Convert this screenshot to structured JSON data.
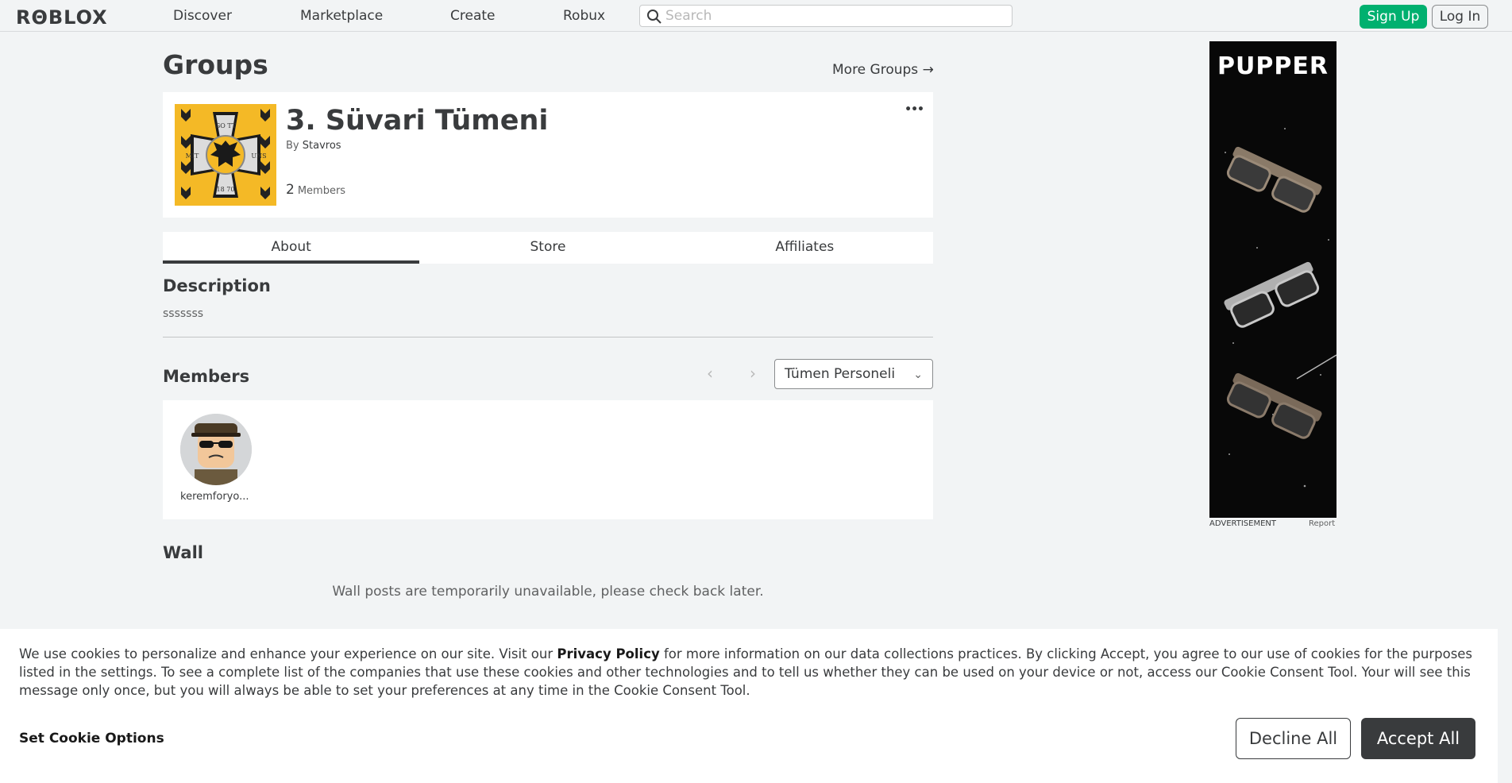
{
  "topbar": {
    "logo": "RΘBLOX",
    "nav": [
      "Discover",
      "Marketplace",
      "Create",
      "Robux"
    ],
    "search_placeholder": "Search",
    "signup_label": "Sign Up",
    "login_label": "Log In"
  },
  "page": {
    "title": "Groups",
    "more_groups": "More Groups →"
  },
  "group": {
    "name": "3. Süvari Tümeni",
    "by_prefix": "By",
    "owner": "Stavros",
    "member_count": "2",
    "members_label": "Members",
    "more_icon": "•••",
    "emblem_text": {
      "top": "GO TT",
      "left": "MIT",
      "right": "UNS",
      "bottom": "18 70"
    }
  },
  "tabs": [
    "About",
    "Store",
    "Affiliates"
  ],
  "about": {
    "description_title": "Description",
    "description": "sssssss",
    "members_title": "Members",
    "role_selected": "Tümen Personeli",
    "members": [
      {
        "name": "keremforyo..."
      }
    ],
    "wall_title": "Wall",
    "wall_message": "Wall posts are temporarily unavailable, please check back later."
  },
  "ad": {
    "title": "PUPPER",
    "label": "ADVERTISEMENT",
    "report": "Report"
  },
  "cookie": {
    "text_before": "We use cookies to personalize and enhance your experience on our site. Visit our ",
    "privacy_link": "Privacy Policy",
    "text_after": " for more information on our data collections practices. By clicking Accept, you agree to our use of cookies for the purposes listed in the settings. To see a complete list of the companies that use these cookies and other technologies and to tell us whether they can be used on your device or not, access our Cookie Consent Tool. Your will see this message only once, but you will always be able to set your preferences at any time in the Cookie Consent Tool.",
    "set_options": "Set Cookie Options",
    "decline": "Decline All",
    "accept": "Accept All"
  },
  "colors": {
    "signup_green": "#00b06f",
    "emblem_yellow": "#f4b926",
    "dark": "#393b3d"
  }
}
